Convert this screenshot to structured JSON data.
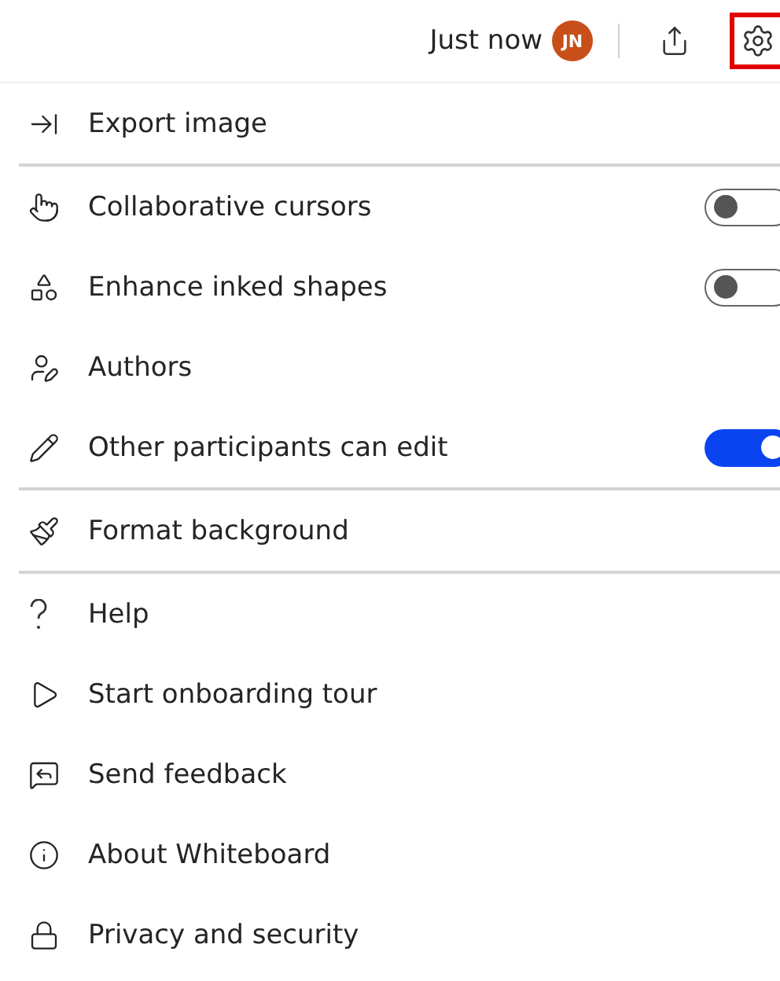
{
  "header": {
    "status": "Just now",
    "avatar": "JN",
    "settings_selected": true
  },
  "menu": [
    {
      "kind": "action",
      "label": "Export image"
    },
    {
      "kind": "divider"
    },
    {
      "kind": "toggle",
      "label": "Collaborative cursors",
      "on": false
    },
    {
      "kind": "toggle",
      "label": "Enhance inked shapes",
      "on": false
    },
    {
      "kind": "action",
      "label": "Authors"
    },
    {
      "kind": "toggle",
      "label": "Other participants can edit",
      "on": true
    },
    {
      "kind": "divider"
    },
    {
      "kind": "action",
      "label": "Format background"
    },
    {
      "kind": "divider"
    },
    {
      "kind": "action",
      "label": "Help"
    },
    {
      "kind": "action",
      "label": "Start onboarding tour"
    },
    {
      "kind": "action",
      "label": "Send feedback"
    },
    {
      "kind": "action",
      "label": "About Whiteboard"
    },
    {
      "kind": "action",
      "label": "Privacy and security"
    }
  ]
}
